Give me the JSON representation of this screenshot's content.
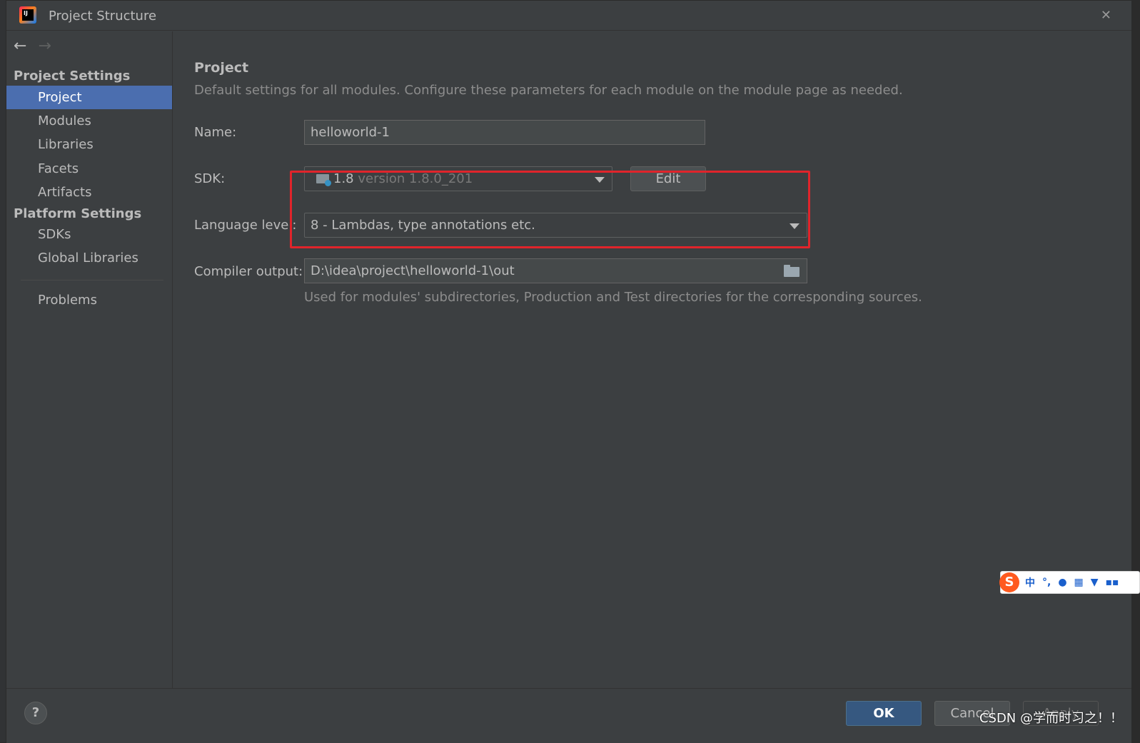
{
  "window": {
    "title": "Project Structure",
    "close_icon": "close-icon"
  },
  "sidebar": {
    "sections": [
      {
        "header": "Project Settings",
        "items": [
          "Project",
          "Modules",
          "Libraries",
          "Facets",
          "Artifacts"
        ]
      },
      {
        "header": "Platform Settings",
        "items": [
          "SDKs",
          "Global Libraries"
        ]
      }
    ],
    "extra_item": "Problems",
    "selected": "Project"
  },
  "main": {
    "title": "Project",
    "description": "Default settings for all modules. Configure these parameters for each module on the module page as needed.",
    "name_label": "Name:",
    "name_value": "helloworld-1",
    "sdk_label": "SDK:",
    "sdk_name": "1.8",
    "sdk_version": "version 1.8.0_201",
    "edit_button": "Edit",
    "language_level_label": "Language level:",
    "language_level_value": "8 - Lambdas, type annotations etc.",
    "compiler_output_label": "Compiler output:",
    "compiler_output_value": "D:\\idea\\project\\helloworld-1\\out",
    "compiler_output_hint": "Used for modules' subdirectories, Production and Test directories for the corresponding sources."
  },
  "footer": {
    "help_label": "?",
    "ok_label": "OK",
    "cancel_label": "Cancel",
    "apply_label": "Apply",
    "watermark": "CSDN @学而时习之！！"
  },
  "ime_toolbar": {
    "logo": "S",
    "mode": "中",
    "punct": "°,"
  },
  "colors": {
    "selection": "#4b6eaf",
    "highlight_box": "#e0242b",
    "primary_button": "#365880"
  }
}
